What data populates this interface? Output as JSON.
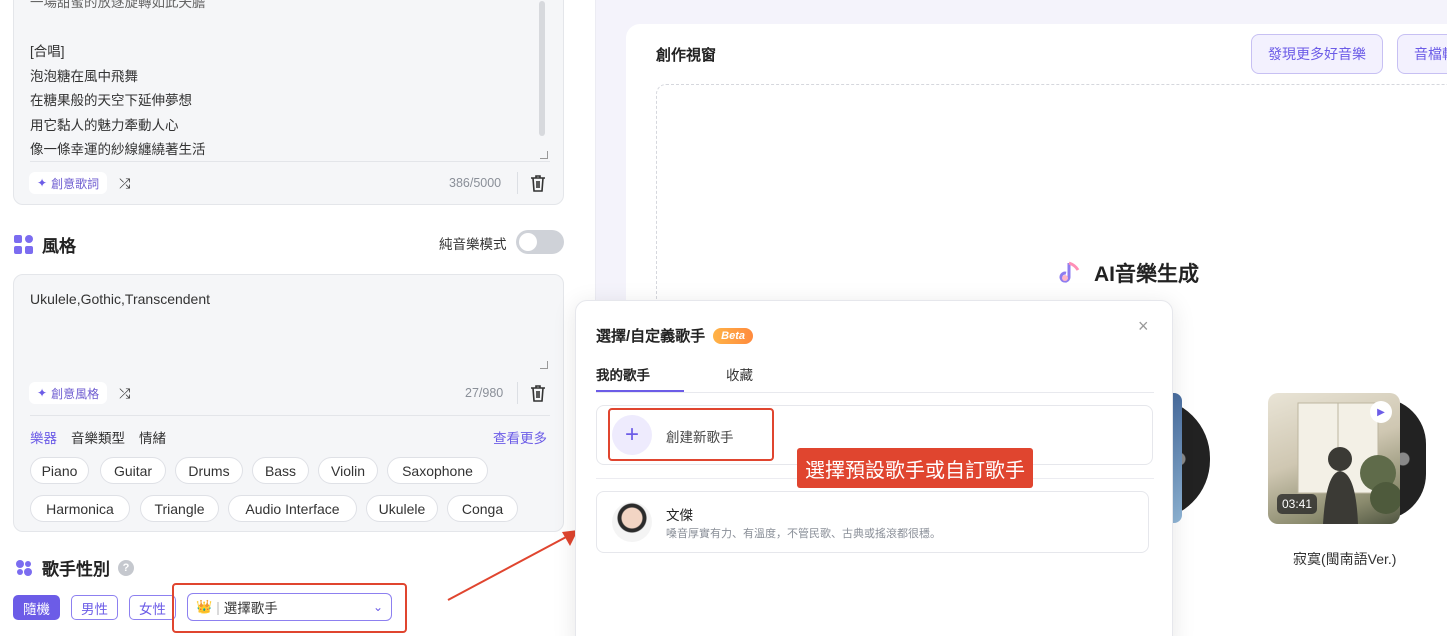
{
  "lyrics": {
    "lines": [
      "一場甜蜜的放逐旋轉如此夭膽",
      "",
      "[合唱]",
      "泡泡糖在風中飛舞",
      "在糖果般的天空下延伸夢想",
      "用它黏人的魅力牽動人心",
      "像一條幸運的紗線纏繞著生活"
    ],
    "creative_btn": "創意歌詞",
    "counter": "386/5000"
  },
  "style": {
    "title": "風格",
    "instrumental_label": "純音樂模式",
    "text": "Ukulele,Gothic,Transcendent",
    "creative_btn": "創意風格",
    "counter": "27/980",
    "tag_tabs": [
      "樂器",
      "音樂類型",
      "情緒"
    ],
    "see_more": "查看更多",
    "tags": [
      "Piano",
      "Guitar",
      "Drums",
      "Bass",
      "Violin",
      "Saxophone",
      "Harmonica",
      "Triangle",
      "Audio Interface",
      "Ukulele",
      "Conga"
    ]
  },
  "gender": {
    "title": "歌手性別",
    "help": "?",
    "options": [
      "隨機",
      "男性",
      "女性"
    ],
    "selected": "隨機",
    "select_placeholder": "選擇歌手"
  },
  "canvas": {
    "title": "創作視窗",
    "buttons": [
      "發現更多好音樂",
      "音檔轉"
    ],
    "ai_title": "AI音樂生成"
  },
  "album": {
    "duration": "03:41",
    "song_name": "寂寞(閩南語Ver.)"
  },
  "modal": {
    "title": "選擇/自定義歌手",
    "beta": "Beta",
    "close": "×",
    "tabs": [
      "我的歌手",
      "收藏"
    ],
    "create_label": "創建新歌手",
    "plus": "+",
    "callout": "選擇預設歌手或自訂歌手",
    "singer": {
      "name": "文傑",
      "desc": "嗓音厚實有力、有溫度，不管民歌、古典或搖滾都很穩。"
    }
  },
  "colors": {
    "accent": "#6c5ce7",
    "annotation_red": "#e0452f",
    "beta_orange": "#ff8a3d"
  }
}
